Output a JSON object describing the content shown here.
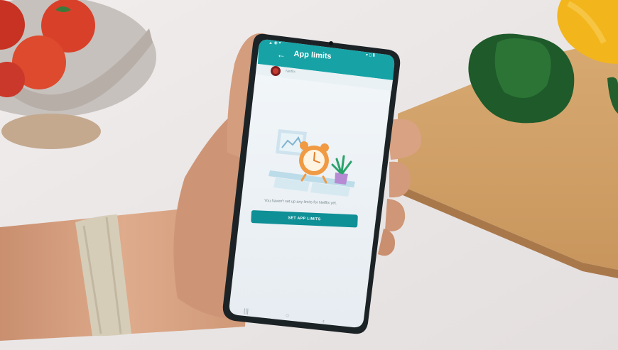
{
  "app_bar": {
    "title": "App limits",
    "back_icon": "arrow-back-icon"
  },
  "app_row": {
    "name": "Netflix",
    "icon": "app-avatar-icon"
  },
  "empty_state": {
    "illustration": "alarm-clock-illustration",
    "message": "You haven't set up any limits for Netflix yet.",
    "button_label": "SET APP LIMITS"
  },
  "nav_bar": {
    "recent_icon": "recent-apps-icon",
    "home_icon": "home-icon",
    "back_icon": "nav-back-icon"
  },
  "colors": {
    "app_bar": "#17a3a6",
    "button": "#0f8f96",
    "screen_bg": "#f0f4f8",
    "clock": "#f09a43"
  }
}
